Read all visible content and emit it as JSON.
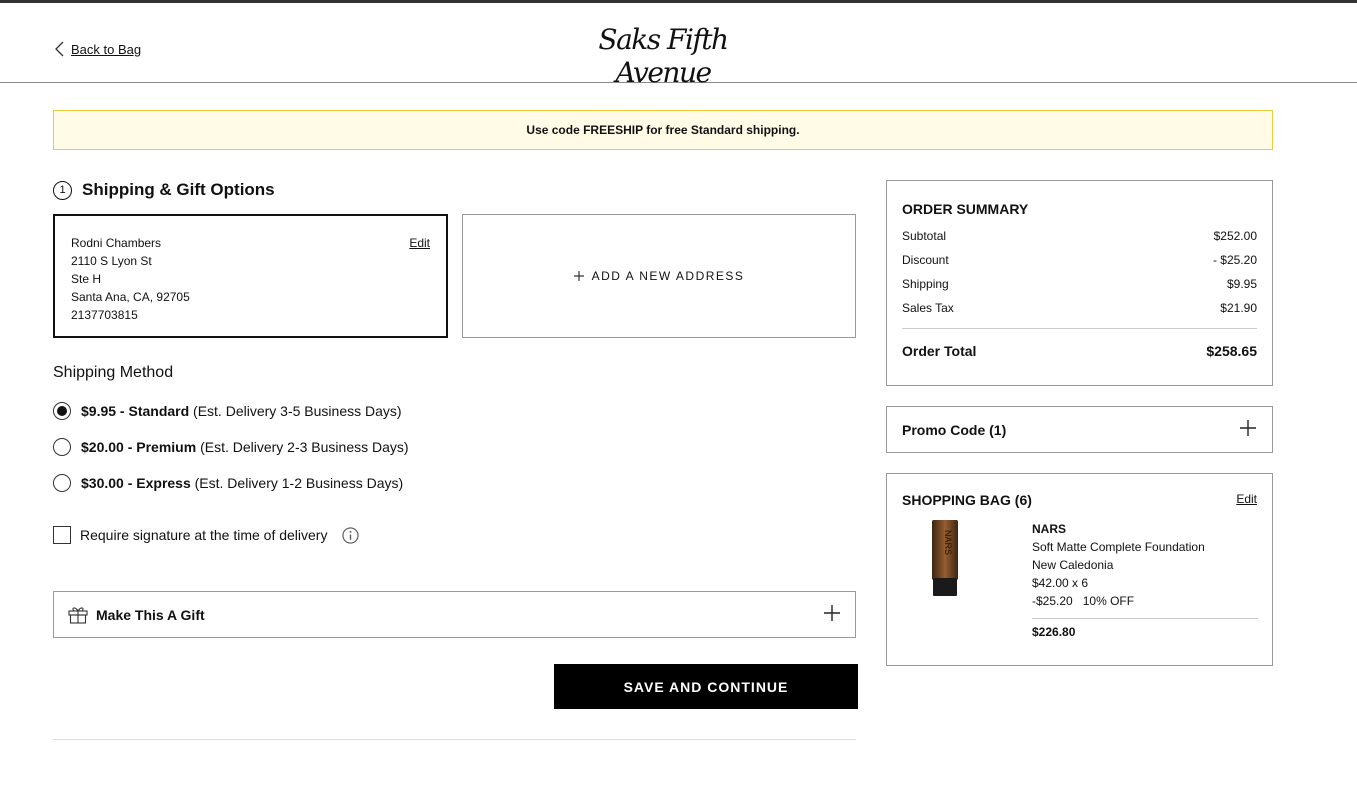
{
  "header": {
    "back_label": "Back to Bag",
    "logo_text": "Saks Fifth Avenue"
  },
  "banner": {
    "text": "Use code FREESHIP for free Standard shipping."
  },
  "shipping": {
    "step": "1",
    "title": "Shipping & Gift Options",
    "address": {
      "name": "Rodni Chambers",
      "line1": "2110 S Lyon St",
      "line2": "Ste H",
      "city_state_zip": "Santa Ana, CA, 92705",
      "phone": "2137703815",
      "edit_label": "Edit"
    },
    "add_address_label": "ADD A NEW ADDRESS",
    "method_title": "Shipping Method",
    "methods": [
      {
        "price_name": "$9.95 - Standard",
        "detail": "(Est. Delivery 3-5 Business Days)",
        "selected": true
      },
      {
        "price_name": "$20.00 - Premium",
        "detail": "(Est. Delivery 2-3 Business Days)",
        "selected": false
      },
      {
        "price_name": "$30.00 - Express",
        "detail": "(Est. Delivery 1-2 Business Days)",
        "selected": false
      }
    ],
    "signature_label": "Require signature at the time of delivery",
    "gift_label": "Make This A Gift",
    "save_label": "SAVE AND CONTINUE"
  },
  "summary": {
    "title": "ORDER SUMMARY",
    "rows": [
      {
        "label": "Subtotal",
        "value": "$252.00"
      },
      {
        "label": "Discount",
        "value": "- $25.20"
      },
      {
        "label": "Shipping",
        "value": "$9.95"
      },
      {
        "label": "Sales Tax",
        "value": "$21.90"
      }
    ],
    "total_label": "Order Total",
    "total_value": "$258.65"
  },
  "promo": {
    "label": "Promo Code (1)"
  },
  "bag": {
    "title": "SHOPPING BAG (6)",
    "edit_label": "Edit",
    "item": {
      "brand": "NARS",
      "name": "Soft Matte Complete Foundation",
      "shade": "New Caledonia",
      "qty_price": "$42.00 x 6",
      "discount": "-$25.20",
      "discount_pct": "10% OFF",
      "line_total": "$226.80"
    }
  },
  "colors": {
    "banner_bg": "#fffbe6",
    "banner_border": "#e6cf3b",
    "primary_button": "#000000"
  }
}
